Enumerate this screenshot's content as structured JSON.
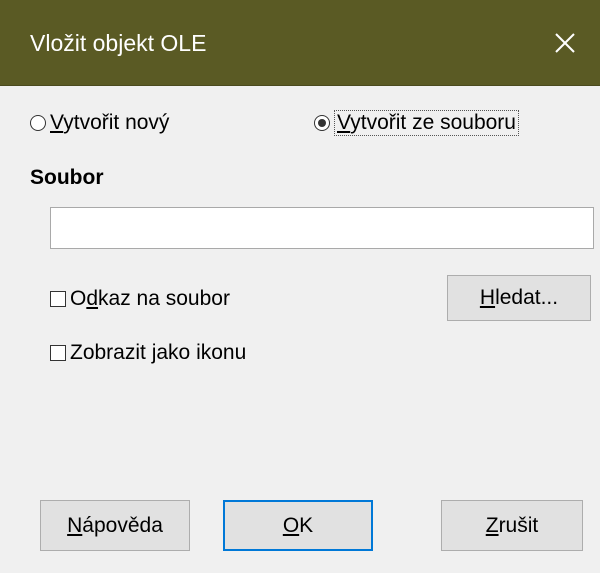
{
  "window": {
    "title": "Vložit objekt OLE",
    "close_icon": "close-icon"
  },
  "options": {
    "create_new": {
      "pre": "",
      "key": "V",
      "post": "ytvořit nový",
      "selected": false
    },
    "create_from_file": {
      "pre": "",
      "key": "V",
      "post": "ytvořit ze souboru",
      "selected": true
    }
  },
  "file_section": {
    "label": "Soubor",
    "path_value": "",
    "link_checkbox": {
      "pre": "O",
      "key": "d",
      "post": "kaz na soubor",
      "checked": false
    },
    "icon_checkbox": {
      "pre": "Zobrazit ",
      "key": "j",
      "post": "ako ikonu",
      "checked": false
    },
    "browse_button": {
      "pre": "",
      "key": "H",
      "post": "ledat..."
    }
  },
  "buttons": {
    "help": {
      "pre": "",
      "key": "N",
      "post": "ápověda"
    },
    "ok": {
      "pre": "",
      "key": "O",
      "post": "K"
    },
    "cancel": {
      "pre": "",
      "key": "Z",
      "post": "rušit"
    }
  },
  "colors": {
    "titlebar": "#5a5a24",
    "dialog_bg": "#f0f0f0",
    "default_button_border": "#0078d7"
  }
}
